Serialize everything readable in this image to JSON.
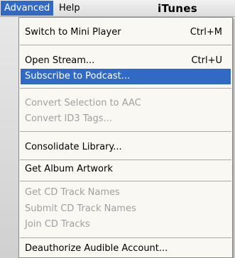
{
  "menubar": {
    "items": [
      {
        "label": "Advanced",
        "active": true
      },
      {
        "label": "Help",
        "active": false
      }
    ],
    "app_title": "iTunes"
  },
  "menu": {
    "items": [
      {
        "label": "Switch to Mini Player",
        "shortcut": "Ctrl+M",
        "enabled": true,
        "highlighted": false
      },
      {
        "label": "Open Stream...",
        "shortcut": "Ctrl+U",
        "enabled": true,
        "highlighted": false
      },
      {
        "label": "Subscribe to Podcast...",
        "shortcut": "",
        "enabled": true,
        "highlighted": true
      },
      {
        "label": "Convert Selection to AAC",
        "shortcut": "",
        "enabled": false,
        "highlighted": false
      },
      {
        "label": "Convert ID3 Tags...",
        "shortcut": "",
        "enabled": false,
        "highlighted": false
      },
      {
        "label": "Consolidate Library...",
        "shortcut": "",
        "enabled": true,
        "highlighted": false
      },
      {
        "label": "Get Album Artwork",
        "shortcut": "",
        "enabled": true,
        "highlighted": false
      },
      {
        "label": "Get CD Track Names",
        "shortcut": "",
        "enabled": false,
        "highlighted": false
      },
      {
        "label": "Submit CD Track Names",
        "shortcut": "",
        "enabled": false,
        "highlighted": false
      },
      {
        "label": "Join CD Tracks",
        "shortcut": "",
        "enabled": false,
        "highlighted": false
      },
      {
        "label": "Deauthorize Audible Account...",
        "shortcut": "",
        "enabled": true,
        "highlighted": false
      }
    ]
  },
  "colors": {
    "highlight": "#316ac5",
    "disabled_text": "#a0a0a0",
    "menu_background": "#f9f8f3"
  }
}
